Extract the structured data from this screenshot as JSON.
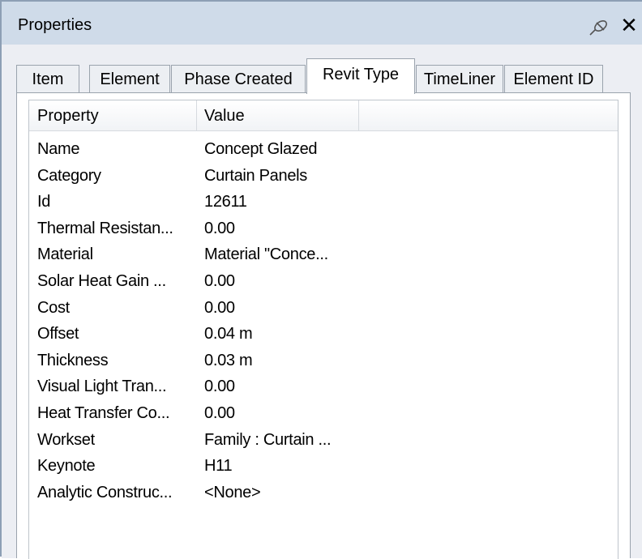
{
  "window": {
    "title": "Properties",
    "pin_icon": "pin-icon",
    "close_label": "✕"
  },
  "tabs": [
    {
      "label": "Item",
      "active": false
    },
    {
      "label": "Element",
      "active": false
    },
    {
      "label": "Phase Created",
      "active": false
    },
    {
      "label": "Revit Type",
      "active": true
    },
    {
      "label": "TimeLiner",
      "active": false
    },
    {
      "label": "Element ID",
      "active": false
    }
  ],
  "table": {
    "columns": [
      "Property",
      "Value"
    ],
    "rows": [
      [
        "Name",
        "Concept Glazed"
      ],
      [
        "Category",
        "Curtain Panels"
      ],
      [
        "Id",
        "12611"
      ],
      [
        "Thermal Resistan...",
        "0.00"
      ],
      [
        "Material",
        "Material \"Conce..."
      ],
      [
        "Solar Heat Gain ...",
        "0.00"
      ],
      [
        "Cost",
        "0.00"
      ],
      [
        "Offset",
        "0.04 m"
      ],
      [
        "Thickness",
        "0.03 m"
      ],
      [
        "Visual Light Tran...",
        "0.00"
      ],
      [
        "Heat Transfer Co...",
        "0.00"
      ],
      [
        "Workset",
        "Family  : Curtain ..."
      ],
      [
        "Keynote",
        "H11"
      ],
      [
        "Analytic Construc...",
        "<None>"
      ]
    ]
  }
}
